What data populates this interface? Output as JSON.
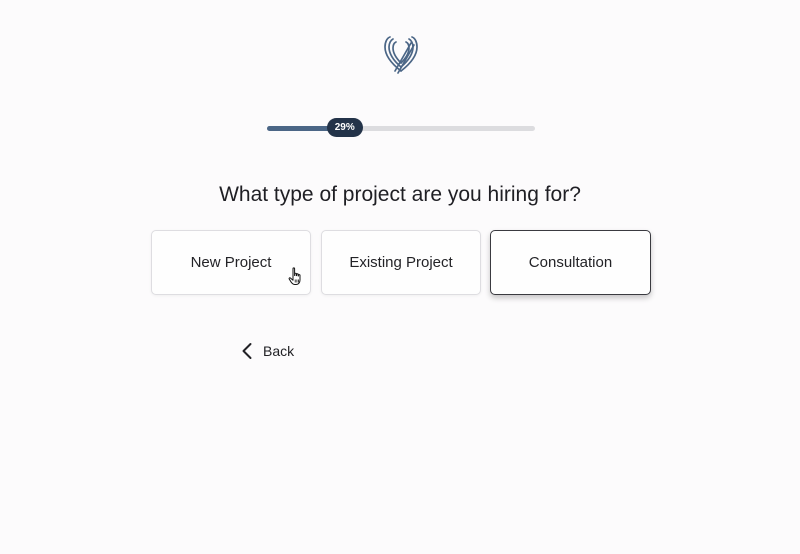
{
  "progress": {
    "percent": 29,
    "label": "29%"
  },
  "question": "What type of project are you hiring for?",
  "options": [
    {
      "label": "New Project",
      "selected": false
    },
    {
      "label": "Existing Project",
      "selected": false
    },
    {
      "label": "Consultation",
      "selected": true
    }
  ],
  "back": {
    "label": "Back",
    "icon": "chevron-left-icon"
  },
  "logo": {
    "icon": "heart-lines-logo",
    "color": "#4b6686"
  },
  "colors": {
    "accent": "#4b6686",
    "badge": "#233349",
    "track": "#dcdcdf"
  }
}
